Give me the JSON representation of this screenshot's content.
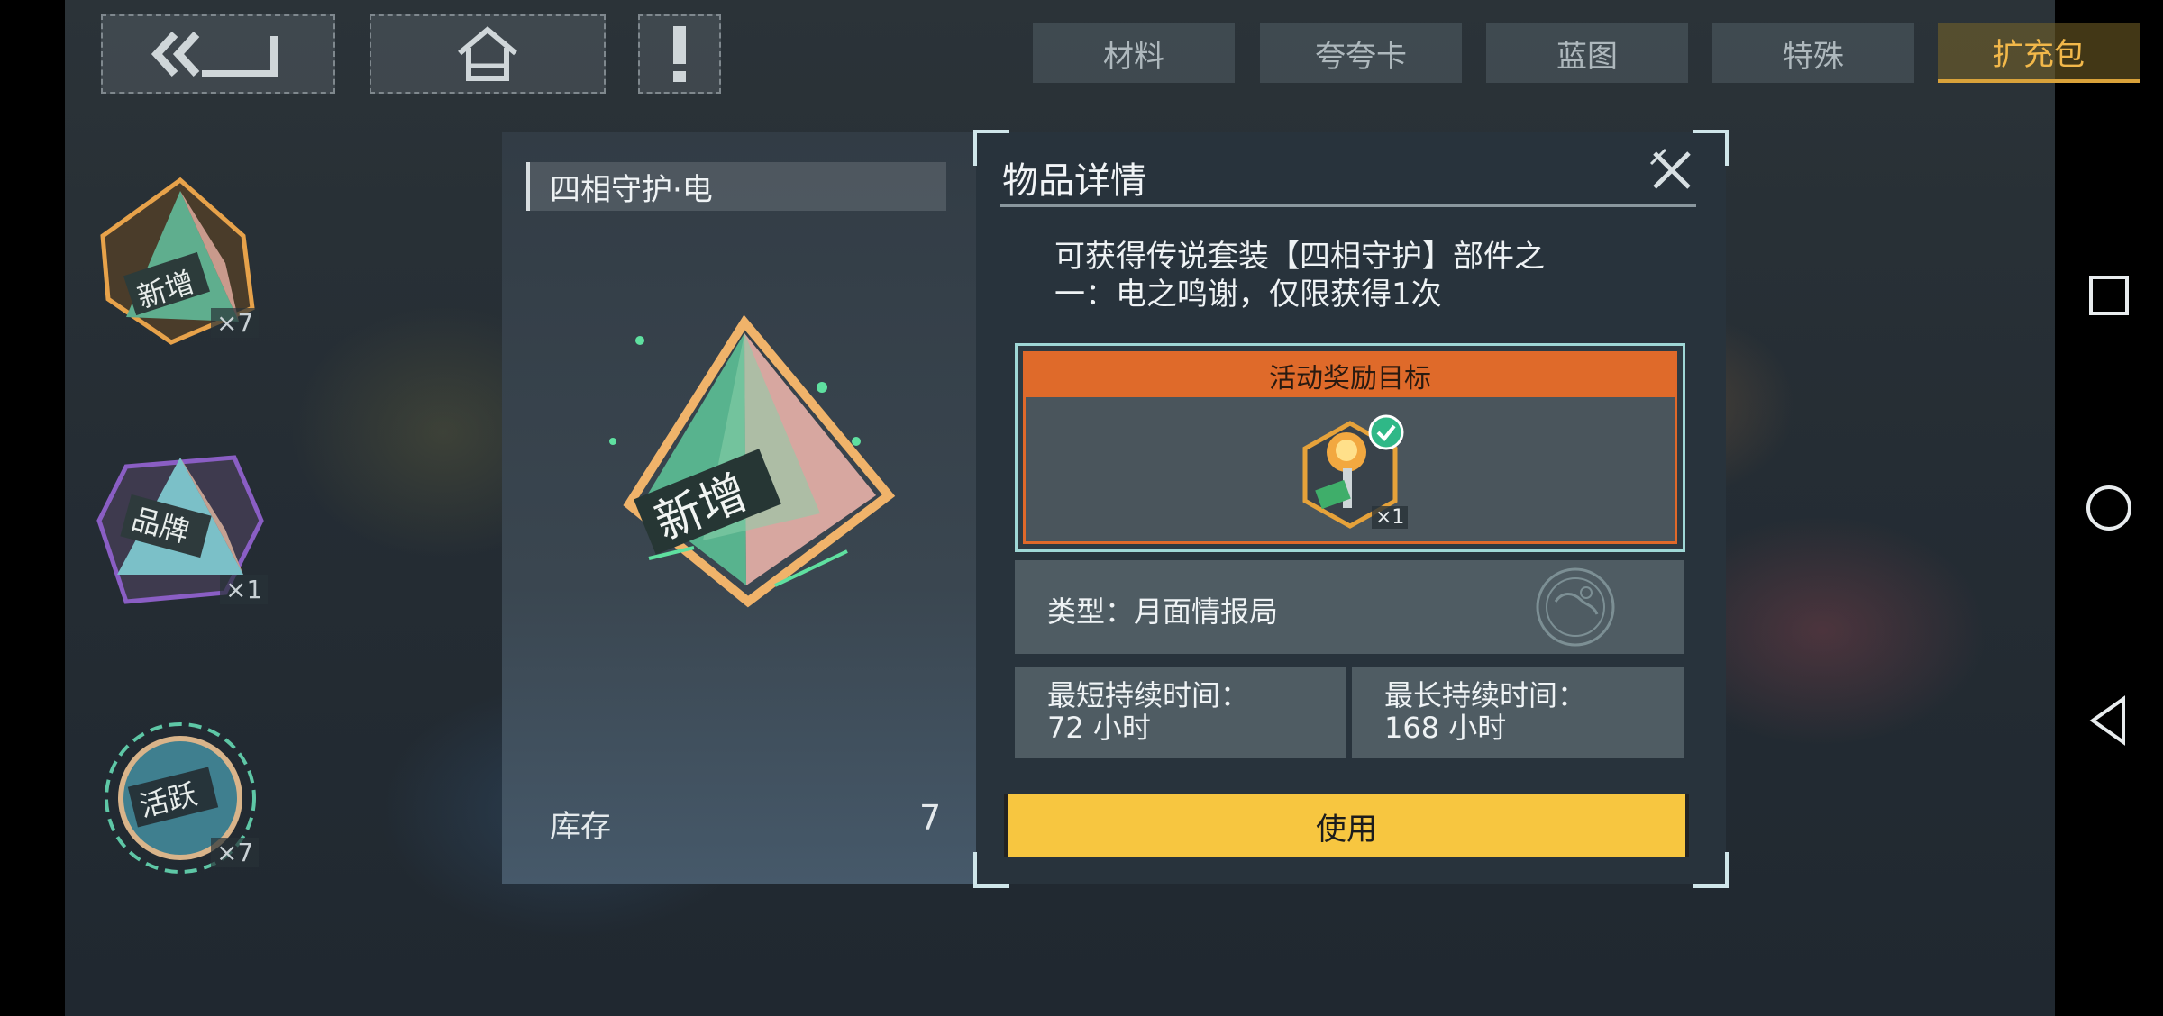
{
  "nav": {
    "tabs": [
      "材料",
      "夸夸卡",
      "蓝图",
      "特殊",
      "扩充包"
    ],
    "active_tab": "扩充包"
  },
  "categories": [
    {
      "label": "新增",
      "count": "×7"
    },
    {
      "label": "品牌",
      "count": "×1"
    },
    {
      "label": "活跃",
      "count": "×7"
    }
  ],
  "item": {
    "name": "四相守护·电",
    "badge_text": "新增",
    "stock_label": "库存",
    "stock_value": "7"
  },
  "detail": {
    "title": "物品详情",
    "description_line1": "可获得传说套装【四相守护】部件之",
    "description_line2": "一：电之鸣谢，仅限获得1次",
    "reward_header": "活动奖励目标",
    "reward_count": "×1",
    "type_text": "类型：月面情报局",
    "min_duration_label": "最短持续时间：",
    "min_duration_value": "72 小时",
    "max_duration_label": "最长持续时间：",
    "max_duration_value": "168 小时",
    "use_button": "使用"
  },
  "colors": {
    "accent_yellow": "#f7c640",
    "reward_orange": "#df6a2a",
    "active_tab_gold": "#f2b84a"
  },
  "icons": [
    "back-icon",
    "home-icon",
    "alert-icon",
    "close-icon",
    "globe-icon",
    "check-icon",
    "recent-apps-icon",
    "home-circle-icon",
    "back-triangle-icon"
  ]
}
